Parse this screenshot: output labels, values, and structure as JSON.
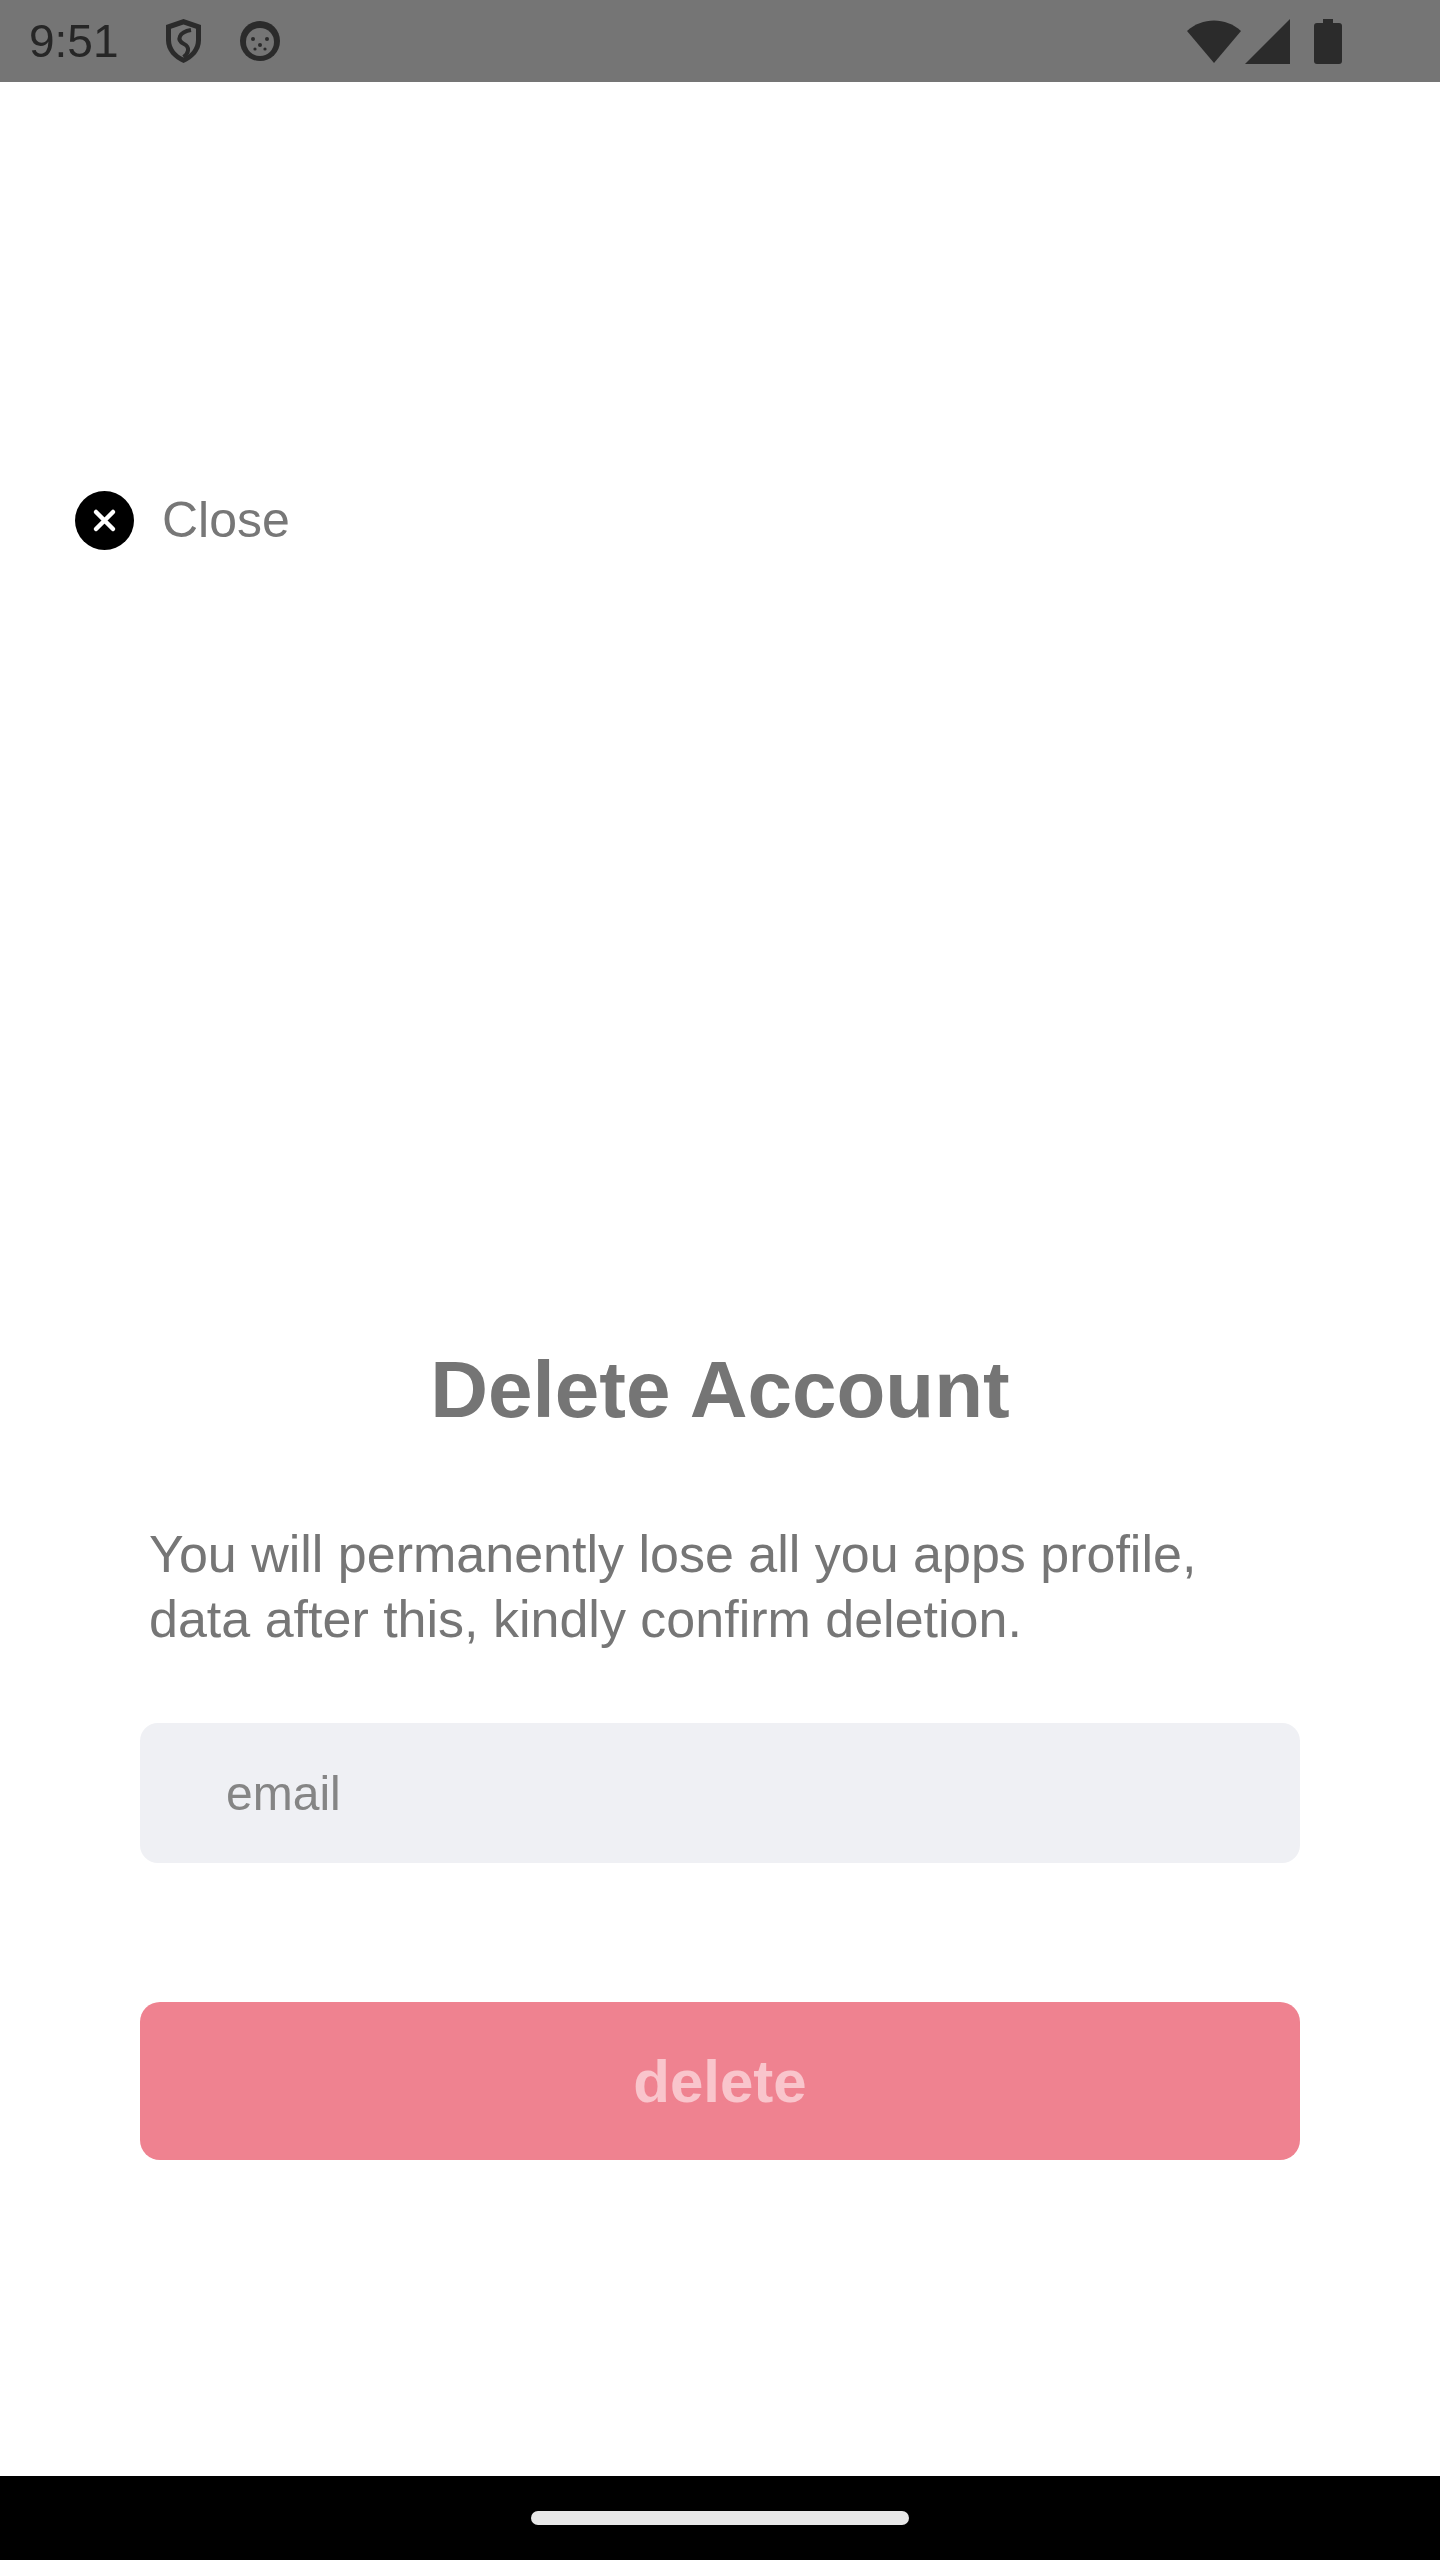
{
  "status_bar": {
    "time": "9:51"
  },
  "close_button": {
    "label": "Close"
  },
  "title": "Delete Account",
  "message": "You will permanently lose all you apps profile, data after this, kindly confirm deletion.",
  "email_field": {
    "placeholder": "email"
  },
  "delete_button": {
    "label": "delete",
    "disabled": true
  }
}
